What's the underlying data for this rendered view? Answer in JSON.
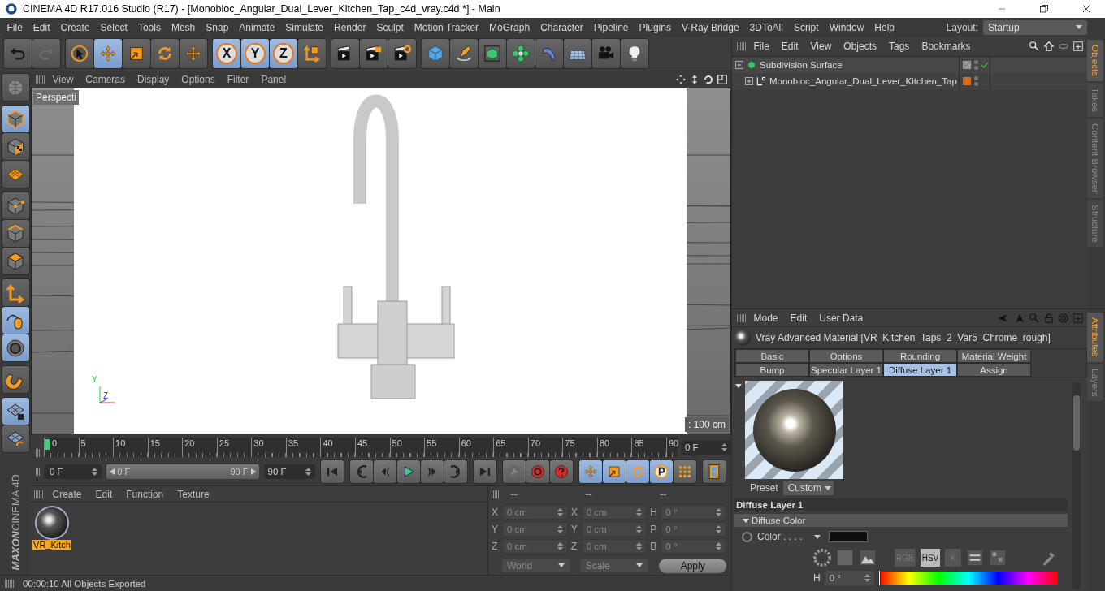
{
  "window": {
    "title": "CINEMA 4D R17.016 Studio (R17) - [Monobloc_Angular_Dual_Lever_Kitchen_Tap_c4d_vray.c4d *] - Main"
  },
  "menu_bar": {
    "items": [
      "File",
      "Edit",
      "Create",
      "Select",
      "Tools",
      "Mesh",
      "Snap",
      "Animate",
      "Simulate",
      "Render",
      "Sculpt",
      "Motion Tracker",
      "MoGraph",
      "Character",
      "Pipeline",
      "Plugins",
      "V-Ray Bridge",
      "3DToAll",
      "Script",
      "Window",
      "Help"
    ],
    "layout_label": "Layout:",
    "layout_value": "Startup"
  },
  "toolbar": {
    "groups": [
      [
        {
          "kind": "undo",
          "selected": false
        },
        {
          "kind": "redo",
          "selected": false
        }
      ],
      [
        {
          "kind": "select",
          "selected": false
        },
        {
          "kind": "move",
          "selected": true
        },
        {
          "kind": "scale",
          "selected": false
        },
        {
          "kind": "rotate",
          "selected": false
        },
        {
          "kind": "transform",
          "selected": false
        }
      ],
      [
        {
          "kind": "axis",
          "label": "X",
          "selected": true
        },
        {
          "kind": "axis",
          "label": "Y",
          "selected": true
        },
        {
          "kind": "axis",
          "label": "Z",
          "selected": true
        },
        {
          "kind": "coord",
          "selected": false
        }
      ],
      [
        {
          "kind": "render-view",
          "selected": false
        },
        {
          "kind": "render-picture",
          "selected": false
        },
        {
          "kind": "render-settings",
          "selected": false
        }
      ],
      [
        {
          "kind": "cube",
          "selected": false
        },
        {
          "kind": "pen",
          "selected": false
        },
        {
          "kind": "subdivision",
          "selected": false
        },
        {
          "kind": "cloner",
          "selected": false
        },
        {
          "kind": "deformer",
          "selected": false
        },
        {
          "kind": "floor",
          "selected": false
        },
        {
          "kind": "camera",
          "selected": false
        },
        {
          "kind": "light",
          "selected": false
        }
      ]
    ]
  },
  "left_tools": {
    "groups": [
      [
        {
          "kind": "world",
          "selected": false
        }
      ],
      [
        {
          "kind": "model",
          "selected": true
        },
        {
          "kind": "texture",
          "selected": false
        },
        {
          "kind": "workplane",
          "selected": false
        }
      ],
      [
        {
          "kind": "points",
          "selected": false
        },
        {
          "kind": "edges",
          "selected": false
        },
        {
          "kind": "polygons",
          "selected": false
        }
      ],
      [
        {
          "kind": "axis-mode",
          "selected": false
        },
        {
          "kind": "tweak",
          "selected": true
        },
        {
          "kind": "snap",
          "selected": true
        }
      ],
      [
        {
          "kind": "magnet",
          "selected": false
        }
      ],
      [
        {
          "kind": "lock-grid",
          "selected": true
        },
        {
          "kind": "sync-grid",
          "selected": false
        }
      ]
    ]
  },
  "logo": {
    "brand": "MAXON",
    "product": "CINEMA 4D"
  },
  "viewport": {
    "menu": [
      "View",
      "Cameras",
      "Display",
      "Options",
      "Filter",
      "Panel"
    ],
    "camera_label": "Perspecti",
    "gizmo_labels": [
      "Y",
      "Z"
    ],
    "grid_label": ": 100 cm"
  },
  "timeline": {
    "ticks": [
      "0",
      "5",
      "10",
      "15",
      "20",
      "25",
      "30",
      "35",
      "40",
      "45",
      "50",
      "55",
      "60",
      "65",
      "70",
      "75",
      "80",
      "85",
      "90"
    ],
    "current_frame": "0 F"
  },
  "transport": {
    "start": "0 F",
    "range": {
      "start": "0 F",
      "end": "90 F"
    },
    "end": "90 F",
    "playback": [
      {
        "kind": "go-start"
      },
      {
        "kind": "prev-key"
      },
      {
        "kind": "prev-frame"
      },
      {
        "kind": "play"
      },
      {
        "kind": "next-frame"
      },
      {
        "kind": "next-key"
      },
      {
        "kind": "go-end"
      }
    ],
    "record": [
      {
        "kind": "key-lock"
      },
      {
        "kind": "record"
      },
      {
        "kind": "autokey"
      }
    ],
    "key_filters": [
      {
        "kind": "move",
        "selected": true
      },
      {
        "kind": "scale",
        "selected": true
      },
      {
        "kind": "rotate",
        "selected": true
      },
      {
        "kind": "param",
        "selected": true
      },
      {
        "kind": "pla",
        "selected": false
      }
    ]
  },
  "materials": {
    "menu": [
      "Create",
      "Edit",
      "Function",
      "Texture"
    ],
    "items": [
      {
        "name": "VR_Kitch",
        "selected": true
      }
    ]
  },
  "coordinates": {
    "headers": [
      "--",
      "--",
      "--"
    ],
    "rows": [
      [
        {
          "axis": "X",
          "value": "0 cm"
        },
        {
          "axis": "X",
          "value": "0 cm"
        },
        {
          "axis": "H",
          "value": "0 °"
        }
      ],
      [
        {
          "axis": "Y",
          "value": "0 cm"
        },
        {
          "axis": "Y",
          "value": "0 cm"
        },
        {
          "axis": "P",
          "value": "0 °"
        }
      ],
      [
        {
          "axis": "Z",
          "value": "0 cm"
        },
        {
          "axis": "Z",
          "value": "0 cm"
        },
        {
          "axis": "B",
          "value": "0 °"
        }
      ]
    ],
    "mode": "World",
    "transform": "Scale",
    "apply": "Apply"
  },
  "status_bar": {
    "text": "00:00:10 All Objects Exported"
  },
  "object_manager": {
    "menu": [
      "File",
      "Edit",
      "View",
      "Objects",
      "Tags",
      "Bookmarks"
    ],
    "tree": [
      {
        "name": "Subdivision Surface",
        "kind": "subdivision",
        "expanded": true,
        "children": [
          {
            "name": "Monobloc_Angular_Dual_Lever_Kitchen_Tap",
            "kind": "null",
            "expanded": false
          }
        ]
      }
    ],
    "side_tabs": [
      {
        "label": "Objects",
        "selected": true
      },
      {
        "label": "Takes",
        "selected": false
      },
      {
        "label": "Content Browser",
        "selected": false
      },
      {
        "label": "Structure",
        "selected": false
      }
    ]
  },
  "attributes": {
    "menu": [
      "Mode",
      "Edit",
      "User Data"
    ],
    "title": "Vray Advanced Material [VR_Kitchen_Taps_2_Var5_Chrome_rough]",
    "tabs": [
      {
        "label": "Basic",
        "selected": false
      },
      {
        "label": "Options",
        "selected": false
      },
      {
        "label": "Rounding",
        "selected": false
      },
      {
        "label": "Material Weight",
        "selected": false
      },
      {
        "label": "Bump",
        "selected": false
      },
      {
        "label": "Specular Layer 1",
        "selected": false
      },
      {
        "label": "Diffuse Layer 1",
        "selected": true
      },
      {
        "label": "Assign",
        "selected": false
      }
    ],
    "preset_label": "Preset",
    "preset_value": "Custom",
    "section": "Diffuse Layer 1",
    "group": {
      "label": "Diffuse Color",
      "expanded": true
    },
    "color_field": {
      "label": "Color . . . .",
      "color": "#0e0e0e",
      "animated": false
    },
    "color_modes": [
      {
        "label": "RGB",
        "selected": false
      },
      {
        "label": "HSV",
        "selected": true
      },
      {
        "label": "K",
        "selected": false
      }
    ],
    "hue": {
      "label": "H",
      "value": "0 °",
      "level": 0
    },
    "side_tabs": [
      {
        "label": "Attributes",
        "selected": true
      },
      {
        "label": "Layers",
        "selected": false
      }
    ]
  }
}
